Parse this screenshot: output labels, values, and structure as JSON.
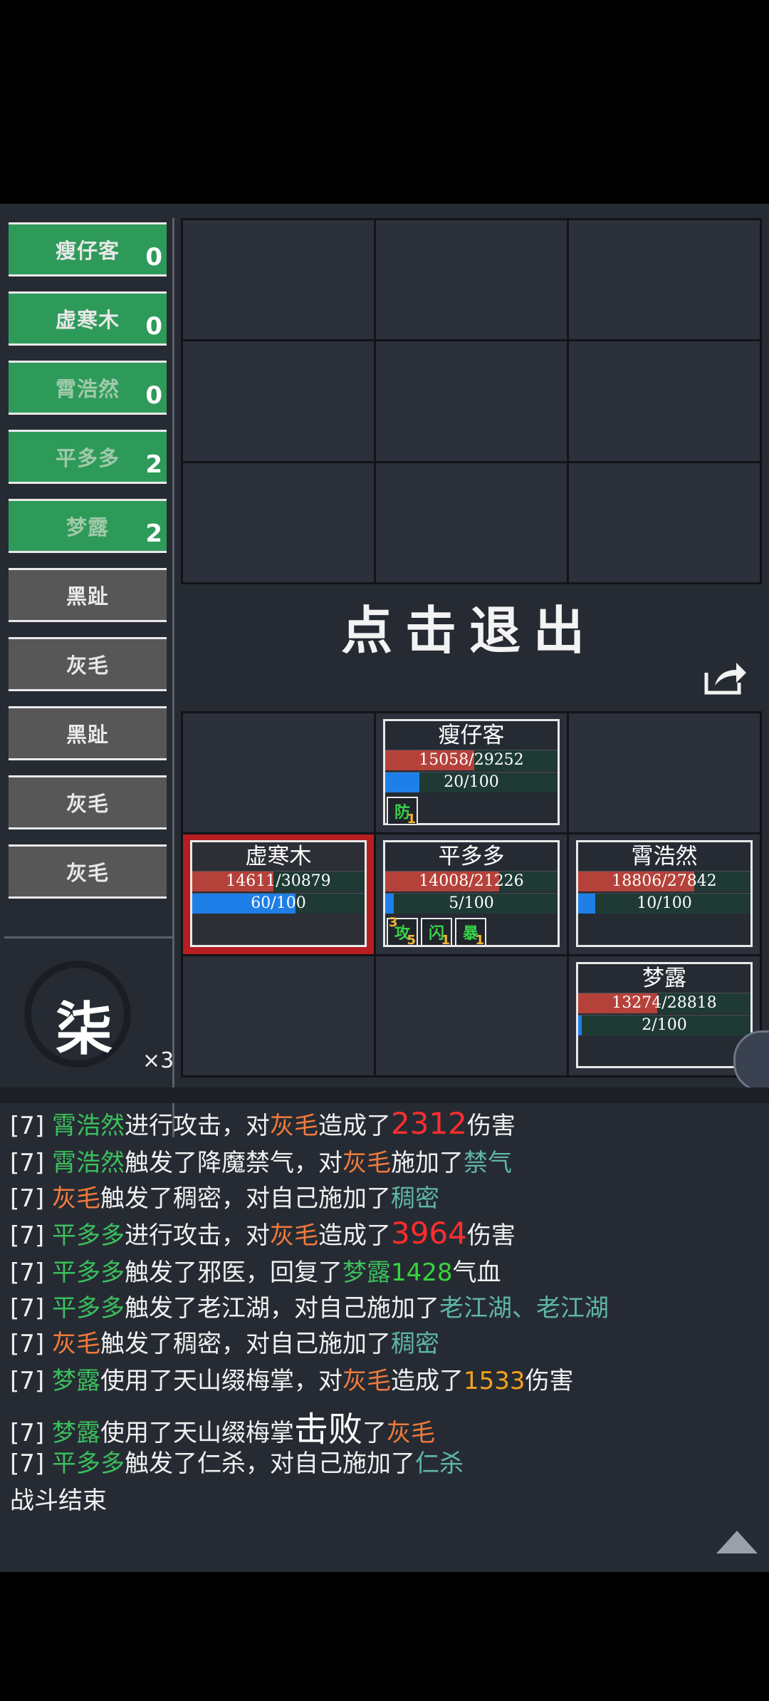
{
  "turn_order": [
    {
      "name": "瘦仔客",
      "count": "0",
      "side": "ally",
      "faded": false
    },
    {
      "name": "虚寒木",
      "count": "0",
      "side": "ally",
      "faded": false
    },
    {
      "name": "霄浩然",
      "count": "0",
      "side": "ally",
      "faded": true
    },
    {
      "name": "平多多",
      "count": "2",
      "side": "ally",
      "faded": true
    },
    {
      "name": "梦露",
      "count": "2",
      "side": "ally",
      "faded": true
    },
    {
      "name": "黑趾",
      "count": "",
      "side": "enemy",
      "faded": false
    },
    {
      "name": "灰毛",
      "count": "",
      "side": "enemy",
      "faded": false
    },
    {
      "name": "黑趾",
      "count": "",
      "side": "enemy",
      "faded": false
    },
    {
      "name": "灰毛",
      "count": "",
      "side": "enemy",
      "faded": false
    },
    {
      "name": "灰毛",
      "count": "",
      "side": "enemy",
      "faded": false
    }
  ],
  "round": {
    "number": "柒",
    "multiplier": "×3"
  },
  "exit_label": "点击退出",
  "units": {
    "top": {
      "name": "瘦仔客",
      "hp": "15058/29252",
      "hp_frac": 0.515,
      "mp": "20/100",
      "mp_frac": 0.2,
      "buffs": [
        {
          "label": "防",
          "stack": "1",
          "level": ""
        }
      ]
    },
    "left": {
      "name": "虚寒木",
      "hp": "14611/30879",
      "hp_frac": 0.473,
      "mp": "60/100",
      "mp_frac": 0.6,
      "buffs": []
    },
    "center": {
      "name": "平多多",
      "hp": "14008/21226",
      "hp_frac": 0.66,
      "mp": "5/100",
      "mp_frac": 0.05,
      "buffs": [
        {
          "label": "攻",
          "stack": "5",
          "level": "3"
        },
        {
          "label": "闪",
          "stack": "1",
          "level": ""
        },
        {
          "label": "暴",
          "stack": "1",
          "level": ""
        }
      ]
    },
    "right": {
      "name": "霄浩然",
      "hp": "18806/27842",
      "hp_frac": 0.675,
      "mp": "10/100",
      "mp_frac": 0.1,
      "buffs": []
    },
    "bottom_right": {
      "name": "梦露",
      "hp": "13274/28818",
      "hp_frac": 0.46,
      "mp": "2/100",
      "mp_frac": 0.02,
      "buffs": []
    }
  },
  "log": {
    "l1": {
      "t": "[7]",
      "a": "霄浩然",
      "b": "进行攻击，对",
      "c": "灰毛",
      "d": "造成了",
      "e": "2312",
      "f": "伤害"
    },
    "l2": {
      "t": "[7]",
      "a": "霄浩然",
      "b": "触发了降魔禁气，对",
      "c": "灰毛",
      "d": "施加了",
      "e": "禁气"
    },
    "l3": {
      "t": "[7]",
      "a": "灰毛",
      "b": "触发了稠密，对自己施加了",
      "c": "稠密"
    },
    "l4": {
      "t": "[7]",
      "a": "平多多",
      "b": "进行攻击，对",
      "c": "灰毛",
      "d": "造成了",
      "e": "3964",
      "f": "伤害"
    },
    "l5": {
      "t": "[7]",
      "a": "平多多",
      "b": "触发了邪医，回复了",
      "c": "梦露",
      "d": "1428",
      "e": "气血"
    },
    "l6": {
      "t": "[7]",
      "a": "平多多",
      "b": "触发了老江湖，对自己施加了",
      "c": "老江湖、老江湖"
    },
    "l7": {
      "t": "[7]",
      "a": "灰毛",
      "b": "触发了稠密，对自己施加了",
      "c": "稠密"
    },
    "l8": {
      "t": "[7]",
      "a": "梦露",
      "b": "使用了天山缀梅掌，对",
      "c": "灰毛",
      "d": "造成了",
      "e": "1533",
      "f": "伤害"
    },
    "l9": {
      "t": "[7]",
      "a": "梦露",
      "b": "使用了天山缀梅掌",
      "c": "击败",
      "d": "了",
      "e": "灰毛"
    },
    "l10": {
      "t": "[7]",
      "a": "平多多",
      "b": "触发了仁杀，对自己施加了",
      "c": "仁杀"
    },
    "end": "战斗结束"
  },
  "icons": {
    "share": "share-icon",
    "collapse": "collapse-up-icon"
  }
}
